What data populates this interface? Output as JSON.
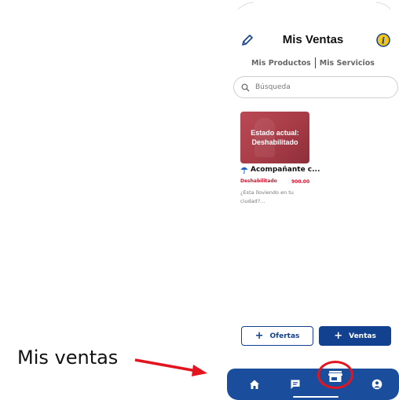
{
  "annotation": {
    "label": "Mis ventas"
  },
  "header": {
    "title": "Mis Ventas",
    "edit_icon": "pencil-icon",
    "info_icon": "info-icon"
  },
  "tabs": [
    {
      "label": "Mis Productos"
    },
    {
      "label": "Mis Servicios"
    }
  ],
  "search": {
    "placeholder": "Búsqueda"
  },
  "card": {
    "overlay_line1": "Estado actual:",
    "overlay_line2": "Deshabilitado",
    "title": "Acompañante c...",
    "title_icon": "umbrella-icon",
    "status": "Deshabilitado",
    "price": "900.00",
    "description": "¿Esta lloviendo en tu ciudad?..."
  },
  "actions": {
    "ofertas_label": "Ofertas",
    "ventas_label": "Ventas"
  },
  "colors": {
    "primary": "#12418f",
    "nav": "#1a4e9c",
    "status": "#d0112b",
    "highlight": "#e3141e"
  },
  "bottom_nav": [
    {
      "icon": "home-icon"
    },
    {
      "icon": "chat-icon"
    },
    {
      "icon": "store-icon"
    },
    {
      "icon": "profile-icon"
    }
  ]
}
